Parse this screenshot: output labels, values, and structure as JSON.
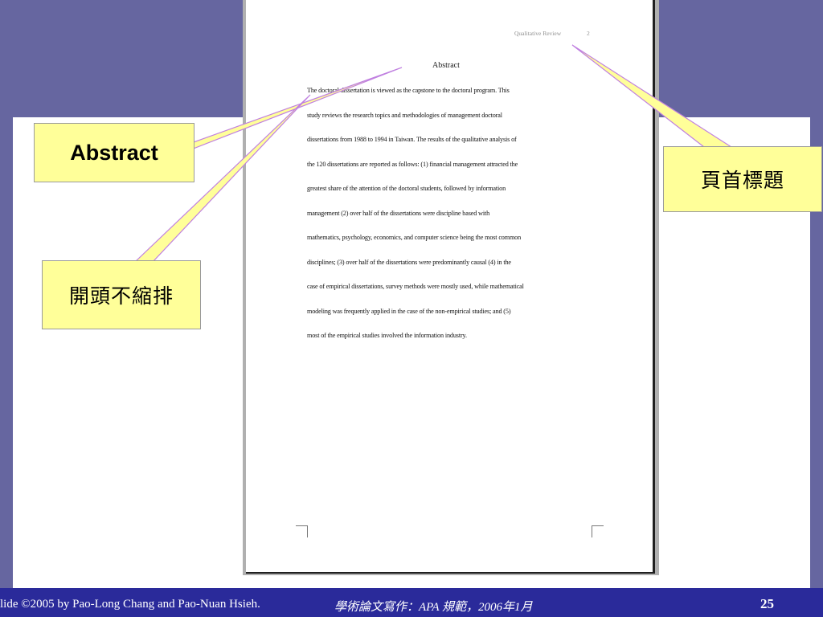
{
  "slide": {
    "footer_credit": "lide ©2005  by Pao-Long Chang and Pao-Nuan Hsieh.",
    "footer_course": "學術論文寫作：APA 規範，2006年1月",
    "slide_number": "25",
    "colors": {
      "background_band": "#6666a0",
      "footer_band": "#2a2a9a",
      "callout_fill": "#ffff99",
      "pointer_stroke": "#c080e0"
    }
  },
  "document": {
    "running_head": "Qualitative Review",
    "page_number": "2",
    "abstract_title": "Abstract",
    "abstract_lines": [
      "The doctoral dissertation is viewed as the capstone to the doctoral program. This",
      "study reviews the research topics and methodologies of management doctoral",
      "dissertations from 1988 to 1994 in Taiwan. The results of the qualitative analysis of",
      "the 120 dissertations are reported as follows: (1) financial management attracted the",
      "greatest share of the attention of the doctoral students, followed by information",
      "management (2) over half of the dissertations were discipline based with",
      "mathematics, psychology, economics, and computer science being the most common",
      "disciplines; (3) over half of the dissertations were predominantly causal (4) in the",
      "case of empirical dissertations, survey methods were mostly used, while mathematical",
      "modeling was frequently applied in the case of the non-empirical studies; and (5)",
      "most of the empirical studies involved the information industry."
    ]
  },
  "callouts": {
    "abstract": "Abstract",
    "no_indent": "開頭不縮排",
    "running_header": "頁首標題"
  }
}
